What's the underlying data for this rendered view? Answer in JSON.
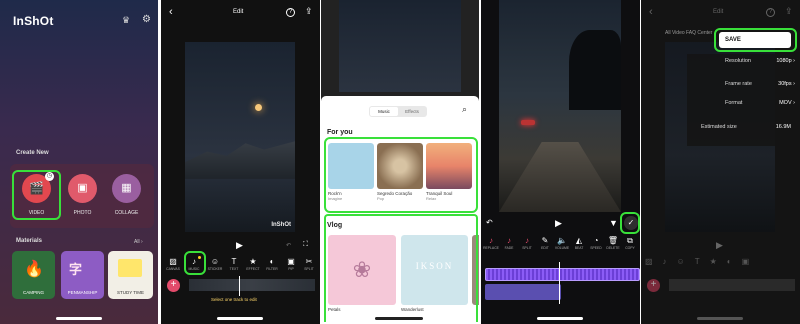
{
  "panel1": {
    "logo": "InShOt",
    "create_new": "Create New",
    "items": [
      {
        "label": "VIDEO",
        "color": "#e2484f",
        "icon": "clapper-icon"
      },
      {
        "label": "PHOTO",
        "color": "#e05a6b",
        "icon": "image-icon"
      },
      {
        "label": "COLLAGE",
        "color": "#9a5fa0",
        "icon": "grid-icon"
      }
    ],
    "materials": "Materials",
    "all": "All",
    "material_cards": [
      {
        "label": "CAMPING",
        "color": "#2f6e3b"
      },
      {
        "label": "PENMANSHIP",
        "color": "#8d5cc4"
      },
      {
        "label": "STUDY TIME",
        "color": "#f2efe6"
      }
    ]
  },
  "panel2": {
    "title": "Edit",
    "watermark": "InShOt",
    "tools": [
      {
        "icon": "canvas-icon",
        "label": "CANVAS"
      },
      {
        "icon": "music-icon",
        "label": "MUSIC"
      },
      {
        "icon": "sticker-icon",
        "label": "STICKER"
      },
      {
        "icon": "text-icon",
        "label": "TEXT"
      },
      {
        "icon": "effect-icon",
        "label": "EFFECT"
      },
      {
        "icon": "filter-icon",
        "label": "FILTER"
      },
      {
        "icon": "pip-icon",
        "label": "PIP"
      },
      {
        "icon": "split-icon",
        "label": "SPLIT"
      }
    ],
    "timeline_hint": "Select one track to edit"
  },
  "panel3": {
    "tabs": [
      "Music",
      "Effects"
    ],
    "for_you": "For you",
    "foryou_cards": [
      {
        "title": "Rock'n",
        "sub": "Imagine",
        "color": "#a8d4e8"
      },
      {
        "title": "Segredo Coração",
        "sub": "Pop",
        "color": "#b79e7f"
      },
      {
        "title": "Tranquil Soul",
        "sub": "Relax",
        "color": "#e8846a"
      }
    ],
    "vlog": "Vlog",
    "vlog_cards": [
      {
        "title": "Petals",
        "sub": "Vlog",
        "color": "#f5c8d8"
      },
      {
        "title": "Wanderlust",
        "sub": "Vlog",
        "color": "#cfe6ec",
        "overlay": "IKSON"
      },
      {
        "title": "",
        "sub": "",
        "color": "#9a8a7a"
      }
    ]
  },
  "panel4": {
    "tools": [
      {
        "icon": "replace-icon",
        "label": "REPLACE"
      },
      {
        "icon": "fade-icon",
        "label": "FADE"
      },
      {
        "icon": "split-icon",
        "label": "SPLIT"
      },
      {
        "icon": "edit-icon",
        "label": "EDIT"
      },
      {
        "icon": "volume-icon",
        "label": "VOLUME"
      },
      {
        "icon": "beat-icon",
        "label": "BEAT"
      },
      {
        "icon": "speed-icon",
        "label": "SPEED"
      },
      {
        "icon": "delete-icon",
        "label": "DELETE"
      },
      {
        "icon": "copy-icon",
        "label": "COPY"
      }
    ]
  },
  "panel5": {
    "title": "Edit",
    "save": "SAVE",
    "caption": "All Video FAQ Center",
    "settings": [
      {
        "label": "Resolution",
        "value": "1080p"
      },
      {
        "label": "Frame rate",
        "value": "30fps"
      },
      {
        "label": "Format",
        "value": "MOV"
      },
      {
        "label": "Estimated size",
        "value": "16.9M"
      }
    ]
  },
  "colors": {
    "highlight": "#39e03a",
    "accent": "#e34b6b",
    "audio_track": "#8b5cf6"
  }
}
